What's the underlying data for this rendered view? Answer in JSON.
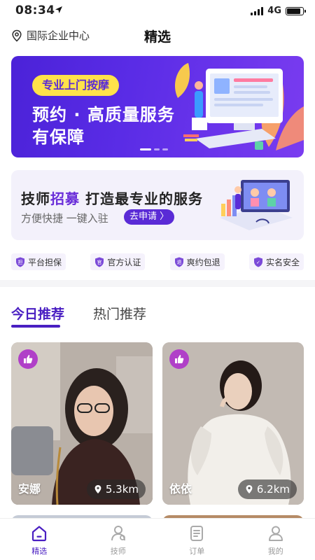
{
  "status": {
    "time": "08:34",
    "network": "4G"
  },
  "header": {
    "location": "国际企业中心",
    "title": "精选"
  },
  "banner": {
    "tag": "专业上门按摩",
    "line1": "预约 · 高质量服务",
    "line2": "有保障"
  },
  "recruit": {
    "title_pre": "技师",
    "title_hl": "招募",
    "title_post": " 打造最专业的服务",
    "subtitle": "方便快捷 一键入驻",
    "button": "去申请 〉"
  },
  "guarantees": [
    {
      "label": "平台担保",
      "icon_char": "担"
    },
    {
      "label": "官方认证",
      "icon_char": "官"
    },
    {
      "label": "爽约包退",
      "icon_char": "退"
    },
    {
      "label": "实名安全",
      "icon_char": "✓"
    }
  ],
  "tabs": {
    "active": "今日推荐",
    "inactive": "热门推荐"
  },
  "cards": [
    {
      "name": "安娜",
      "distance": "5.3km"
    },
    {
      "name": "依依",
      "distance": "6.2km"
    }
  ],
  "tabbar": [
    {
      "label": "精选",
      "icon": "home-icon"
    },
    {
      "label": "技师",
      "icon": "technician-icon"
    },
    {
      "label": "订单",
      "icon": "order-icon"
    },
    {
      "label": "我的",
      "icon": "profile-icon"
    }
  ],
  "colors": {
    "brand": "#4a1fc2",
    "banner": "#5a2ce6",
    "tag": "#ffe24a",
    "badge": "#b040c8"
  }
}
